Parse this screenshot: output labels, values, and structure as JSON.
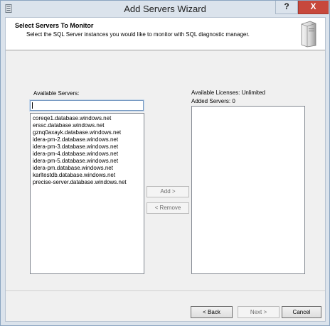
{
  "window": {
    "title": "Add Servers Wizard",
    "help_label": "?",
    "close_label": "X"
  },
  "header": {
    "title": "Select Servers To Monitor",
    "description": "Select the SQL Server instances you would like to monitor with SQL diagnostic manager."
  },
  "available": {
    "label": "Available Servers:",
    "filter_value": "",
    "servers": [
      "coreqe1.database.windows.net",
      "erssc.database.windows.net",
      "gznq0axayk.database.windows.net",
      "idera-pm-2.database.windows.net",
      "idera-pm-3.database.windows.net",
      "idera-pm-4.database.windows.net",
      "idera-pm-5.database.windows.net",
      "idera-pm.database.windows.net",
      "karltestdb.database.windows.net",
      "precise-server.database.windows.net"
    ]
  },
  "licenses": {
    "label": "Available Licenses: Unlimited",
    "added_label": "Added Servers: 0",
    "added_servers": []
  },
  "actions": {
    "add_label": "Add >",
    "remove_label": "< Remove"
  },
  "footer": {
    "back_label": "< Back",
    "next_label": "Next >",
    "cancel_label": "Cancel"
  },
  "colors": {
    "frame": "#dbe3ec",
    "close_button": "#c7483c",
    "client": "#f0f0f0",
    "input_border": "#7a9cc4"
  }
}
